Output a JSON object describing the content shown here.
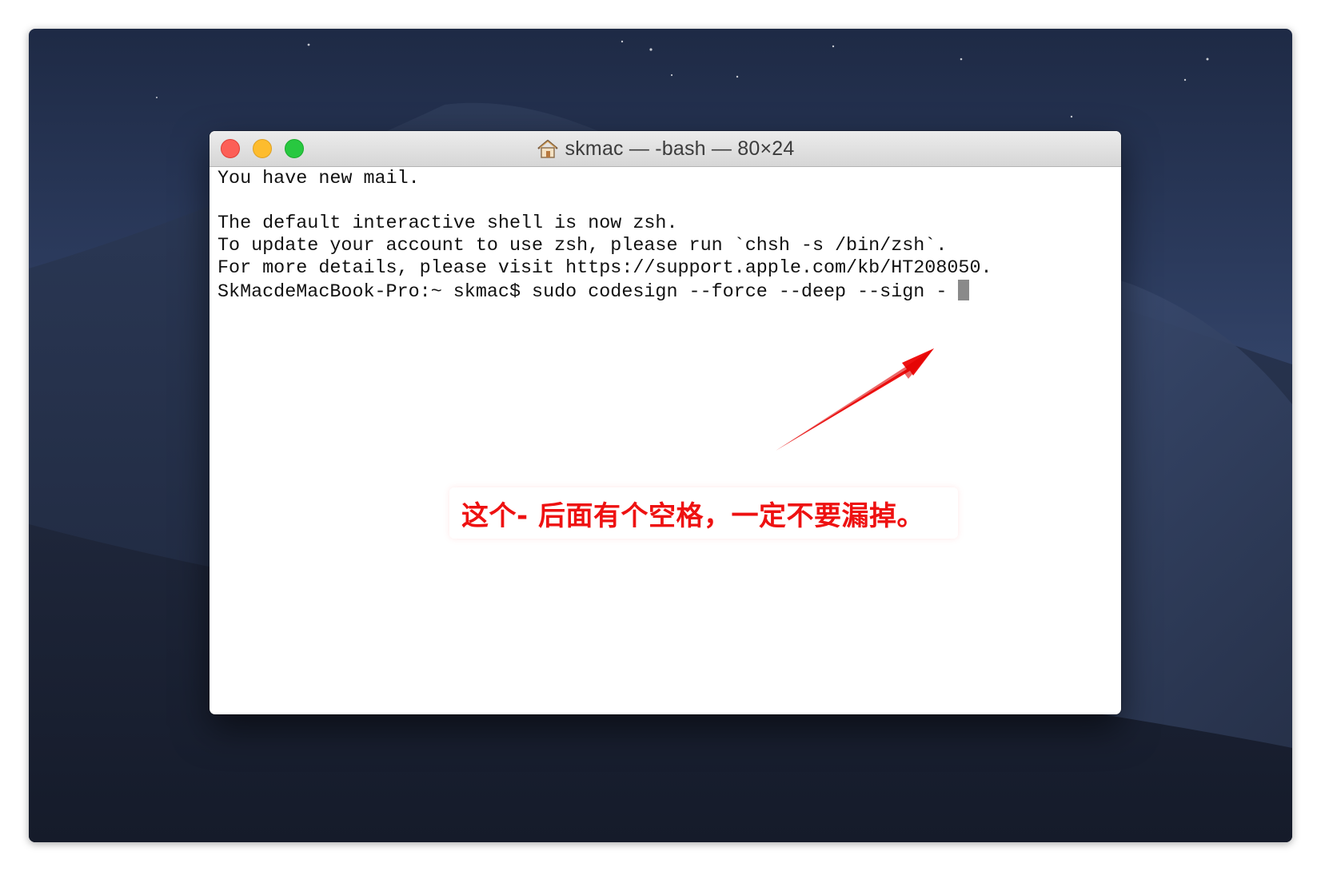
{
  "window": {
    "title": "skmac — -bash — 80×24",
    "title_icon": "home-folder-icon"
  },
  "traffic_lights": {
    "close": "#fc5f57",
    "minimize": "#fdbc2e",
    "maximize": "#28c840"
  },
  "terminal": {
    "lines": [
      "You have new mail.",
      "",
      "The default interactive shell is now zsh.",
      "To update your account to use zsh, please run `chsh -s /bin/zsh`.",
      "For more details, please visit https://support.apple.com/kb/HT208050.",
      "SkMacdeMacBook-Pro:~ skmac$ sudo codesign --force --deep --sign - "
    ]
  },
  "annotation": {
    "text": "这个- 后面有个空格，一定不要漏掉。",
    "color": "#ee1111"
  }
}
